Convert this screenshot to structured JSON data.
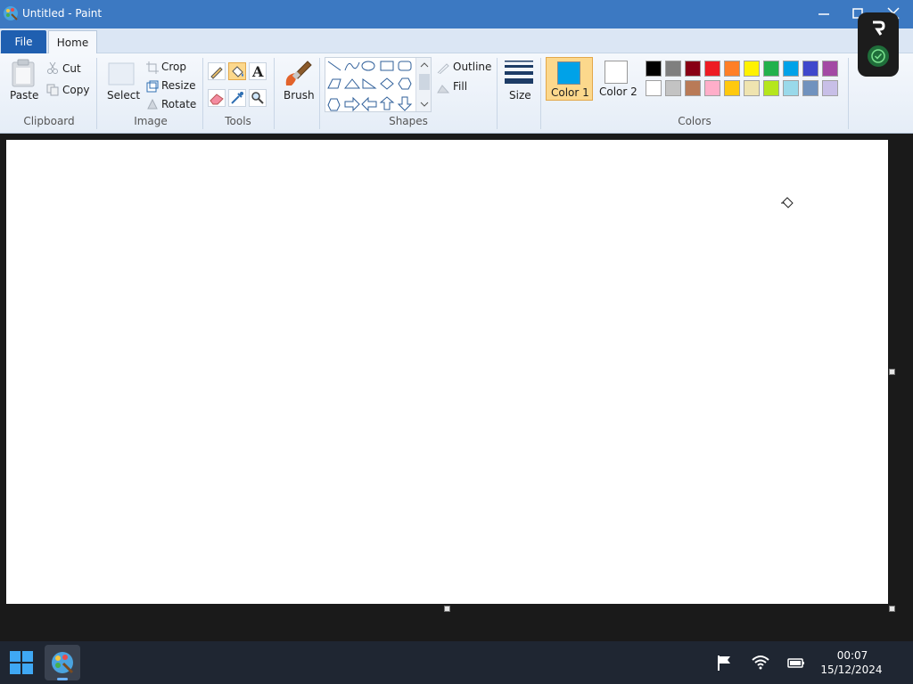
{
  "window": {
    "title": "Untitled - Paint"
  },
  "tabs": {
    "file": "File",
    "home": "Home"
  },
  "clipboard": {
    "group": "Clipboard",
    "paste": "Paste",
    "cut": "Cut",
    "copy": "Copy"
  },
  "image": {
    "group": "Image",
    "select": "Select",
    "crop": "Crop",
    "resize": "Resize",
    "rotate": "Rotate"
  },
  "tools": {
    "group": "Tools"
  },
  "brushes": {
    "label": "Brush"
  },
  "shapes": {
    "group": "Shapes",
    "outline": "Outline",
    "fill": "Fill"
  },
  "size": {
    "label": "Size"
  },
  "colors": {
    "group": "Colors",
    "color1_label": "Color 1",
    "color2_label": "Color 2",
    "color1": "#00a2e8",
    "color2": "#ffffff",
    "palette_row1": [
      "#000000",
      "#7f7f7f",
      "#880015",
      "#ed1c24",
      "#ff7f27",
      "#fff200",
      "#22b14c",
      "#00a2e8",
      "#3f48cc",
      "#a349a4"
    ],
    "palette_row2": [
      "#ffffff",
      "#c3c3c3",
      "#b97a57",
      "#ffaec9",
      "#ffc90e",
      "#efe4b0",
      "#b5e61d",
      "#99d9ea",
      "#7092be",
      "#c8bfe7"
    ]
  },
  "taskbar": {
    "time": "00:07",
    "date": "15/12/2024"
  }
}
